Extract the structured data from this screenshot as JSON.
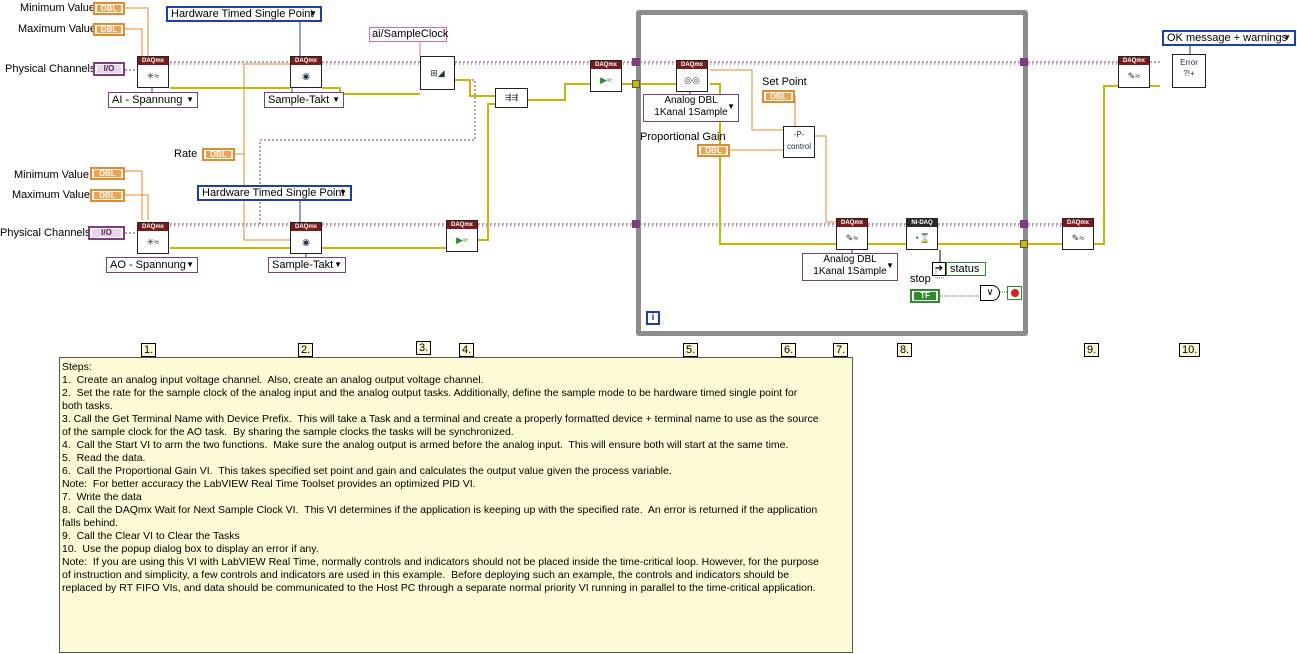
{
  "labels": {
    "min1": "Minimum Value",
    "max1": "Maximum Value",
    "phys1": "Physical Channels",
    "rate": "Rate",
    "min2": "Minimum Value",
    "max2": "Maximum Value",
    "phys2": "Physical Channels",
    "set_point": "Set Point",
    "prop_gain": "Proportional Gain",
    "stop": "stop",
    "status": "status"
  },
  "constants": {
    "dbl": "DBL",
    "io": "I/O",
    "tf": "TF",
    "sample_clock": "ai/SampleClock",
    "iteration": "i"
  },
  "rings": {
    "ai_voltage": "AI - Spannung",
    "ao_voltage": "AO - Spannung",
    "sample_clock1": "Sample-Takt",
    "sample_clock2": "Sample-Takt",
    "hw_timed1": "Hardware Timed Single Point",
    "hw_timed2": "Hardware Timed Single Point",
    "read_mode_line1": "Analog DBL",
    "read_mode_line2": "1Kanal 1Sample",
    "write_mode_line1": "Analog DBL",
    "write_mode_line2": "1Kanal 1Sample",
    "error_mode": "OK message + warnings"
  },
  "vis": {
    "daqmx": "DAQmx",
    "nidaq": "NI-DAQ",
    "control": "control",
    "error": "Error"
  },
  "steps": [
    "1.",
    "2.",
    "3.",
    "4.",
    "5.",
    "6.",
    "7.",
    "8.",
    "9.",
    "10."
  ],
  "notes": "Steps:\n1.  Create an analog input voltage channel.  Also, create an analog output voltage channel.\n2.  Set the rate for the sample clock of the analog input and the analog output tasks. Additionally, define the sample mode to be hardware timed single point for\nboth tasks.\n3. Call the Get Terminal Name with Device Prefix.  This will take a Task and a terminal and create a properly formatted device + terminal name to use as the source\nof the sample clock for the AO task.  By sharing the sample clocks the tasks will be synchronized.\n4.  Call the Start VI to arm the two functions.  Make sure the analog output is armed before the analog input.  This will ensure both will start at the same time.\n5.  Read the data.\n6.  Call the Proportional Gain VI.  This takes specified set point and gain and calculates the output value given the process variable.\nNote:  For better accuracy the LabVIEW Real Time Toolset provides an optimized PID VI.\n7.  Write the data\n8.  Call the DAQmx Wait for Next Sample Clock VI.  This VI determines if the application is keeping up with the specified rate.  An error is returned if the application\nfalls behind.\n9.  Call the Clear VI to Clear the Tasks\n10.  Use the popup dialog box to display an error if any.\nNote:  If you are using this VI with LabVIEW Real Time, normally controls and indicators should not be placed inside the time-critical loop. However, for the purpose\nof instruction and simplicity, a few controls and indicators are used in this example.  Before deploying such an example, the controls and indicators should be\nreplaced by RT FIFO VIs, and data should be communicated to the Host PC through a separate normal priority VI running in parallel to the time-critical application.",
  "colors": {
    "task_wire": "#7d3e7d",
    "error_wire": "#c8b800",
    "dbl_wire": "#e58a2a",
    "enum_wire": "#1c3fae",
    "string_wire": "#e060c0",
    "bool_wire": "#2e8b2e",
    "loop_border": "#8c8c8c"
  }
}
